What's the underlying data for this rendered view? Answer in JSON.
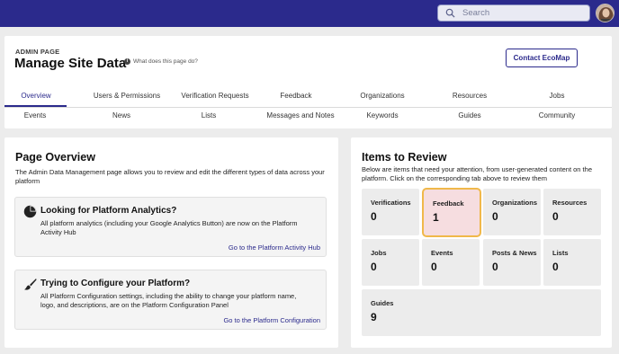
{
  "search": {
    "placeholder": "Search"
  },
  "header": {
    "eyebrow": "ADMIN PAGE",
    "title": "Manage Site Data",
    "help_label": "What does this page do?",
    "contact_label": "Contact EcoMap"
  },
  "tabs": {
    "row1": [
      "Overview",
      "Users & Permissions",
      "Verification Requests",
      "Feedback",
      "Organizations",
      "Resources",
      "Jobs"
    ],
    "row2": [
      "Events",
      "News",
      "Lists",
      "Messages and Notes",
      "Keywords",
      "Guides",
      "Community"
    ],
    "active": "Overview"
  },
  "overview": {
    "title": "Page Overview",
    "description": "The Admin Data Management page allows you to review and edit the different types of data across your platform",
    "analytics": {
      "title": "Looking for Platform Analytics?",
      "text": "All platform analytics (including your Google Analytics Button) are now on the Platform Activity Hub",
      "link": "Go to the Platform Activity Hub",
      "icon": "pie-chart-icon"
    },
    "configure": {
      "title": "Trying to Configure your Platform?",
      "text": "All Platform Configuration settings, including the ability to change your platform name, logo, and descriptions, are on the Platform Configuration Panel",
      "link": "Go to the Platform Configuration",
      "icon": "paintbrush-icon"
    }
  },
  "review": {
    "title": "Items to Review",
    "description": "Below are items that need your attention, from user-generated content on the platform. Click on the corresponding tab above to review them",
    "tiles": [
      {
        "label": "Verifications",
        "count": "0"
      },
      {
        "label": "Feedback",
        "count": "1"
      },
      {
        "label": "Organizations",
        "count": "0"
      },
      {
        "label": "Resources",
        "count": "0"
      },
      {
        "label": "Jobs",
        "count": "0"
      },
      {
        "label": "Events",
        "count": "0"
      },
      {
        "label": "Posts & News",
        "count": "0"
      },
      {
        "label": "Lists",
        "count": "0"
      },
      {
        "label": "Guides",
        "count": "9"
      }
    ],
    "highlighted": "Feedback"
  },
  "colors": {
    "brand": "#2b2a8c",
    "highlight_border": "#f0b84a",
    "highlight_fill": "#f6dde0"
  }
}
